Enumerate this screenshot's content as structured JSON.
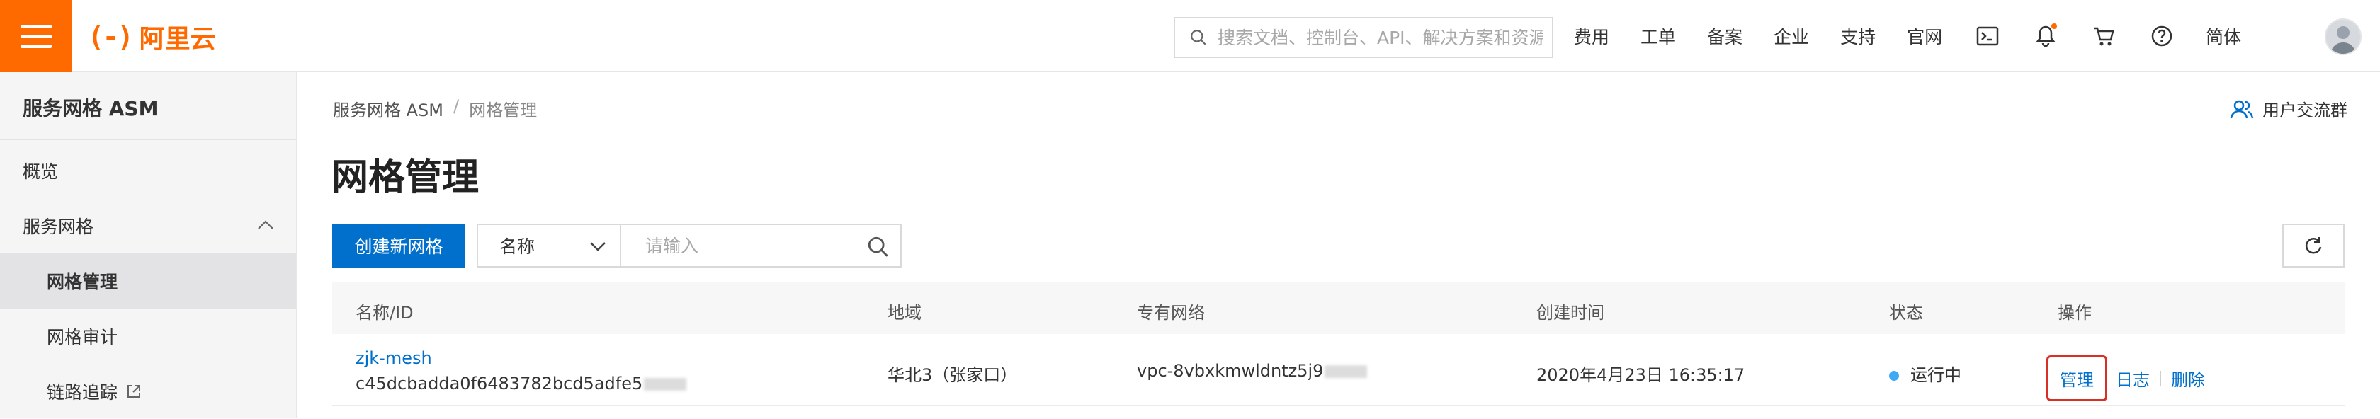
{
  "header": {
    "logo_text": "阿里云",
    "search_placeholder": "搜索文档、控制台、API、解决方案和资源",
    "nav": [
      "费用",
      "工单",
      "备案",
      "企业",
      "支持",
      "官网"
    ],
    "language": "简体",
    "icons": [
      "terminal-icon",
      "bell-icon",
      "cart-icon",
      "help-icon"
    ]
  },
  "sidebar": {
    "title": "服务网格 ASM",
    "items": [
      {
        "label": "概览",
        "level": 1
      },
      {
        "label": "服务网格",
        "level": 1,
        "expanded": true
      },
      {
        "label": "网格管理",
        "level": 2,
        "active": true
      },
      {
        "label": "网格审计",
        "level": 2
      },
      {
        "label": "链路追踪",
        "level": 2,
        "external": true
      }
    ]
  },
  "main": {
    "breadcrumb": [
      "服务网格 ASM",
      "网格管理"
    ],
    "breadcrumb_sep": "/",
    "title": "网格管理",
    "community": "用户交流群",
    "create_button": "创建新网格",
    "filter": {
      "selected": "名称",
      "placeholder": "请输入"
    }
  },
  "table": {
    "columns": [
      "名称/ID",
      "地域",
      "专有网络",
      "创建时间",
      "状态",
      "操作"
    ],
    "rows": [
      {
        "name": "zjk-mesh",
        "id": "c45dcbadda0f6483782bcd5adfe5",
        "region": "华北3（张家口）",
        "vpc": "vpc-8vbxkmwldntz5j9",
        "created": "2020年4月23日 16:35:17",
        "status": "运行中",
        "actions": [
          "管理",
          "日志",
          "删除"
        ]
      }
    ]
  },
  "colors": {
    "brand": "#ff6a00",
    "primary": "#0070cc",
    "status_running": "#3fa9f5",
    "highlight": "#d93026"
  }
}
